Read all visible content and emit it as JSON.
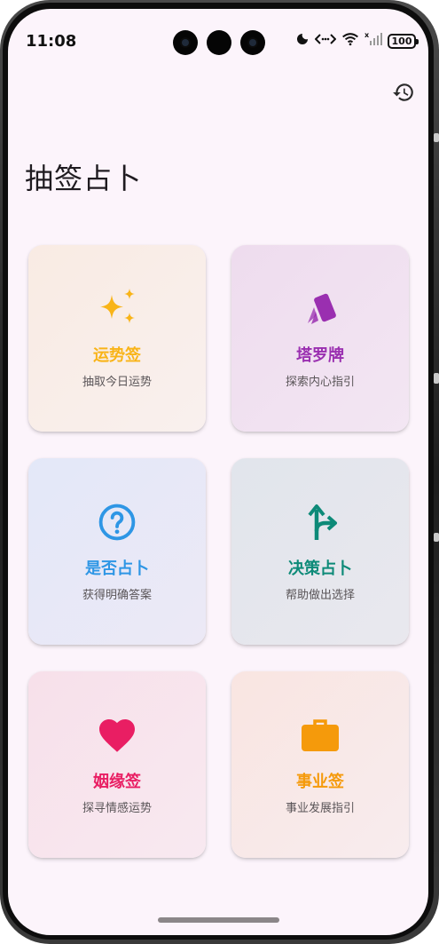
{
  "status_bar": {
    "time": "11:08",
    "battery": "100",
    "icons": [
      "moon-icon",
      "data-transfer-icon",
      "wifi-icon",
      "signal-icon",
      "battery-icon"
    ]
  },
  "header": {
    "history_icon": "history-icon",
    "title": "抽签占卜"
  },
  "cards": [
    {
      "title": "运势签",
      "subtitle": "抽取今日运势",
      "icon": "sparkles-icon",
      "color": "#f9b418",
      "bg": [
        "#f9ebe3",
        "#f9f0ee"
      ]
    },
    {
      "title": "塔罗牌",
      "subtitle": "探索内心指引",
      "icon": "cards-icon",
      "color": "#9a2fb0",
      "bg": [
        "#eedcee",
        "#f3e6f3"
      ]
    },
    {
      "title": "是否占卜",
      "subtitle": "获得明确答案",
      "icon": "question-circle-icon",
      "color": "#2e96e5",
      "bg": [
        "#e3e8f8",
        "#ece9f6"
      ]
    },
    {
      "title": "决策占卜",
      "subtitle": "帮助做出选择",
      "icon": "fork-arrow-icon",
      "color": "#0d8a78",
      "bg": [
        "#e1e5ec",
        "#e9e8ee"
      ]
    },
    {
      "title": "姻缘签",
      "subtitle": "探寻情感运势",
      "icon": "heart-icon",
      "color": "#e91e63",
      "bg": [
        "#f7e0ea",
        "#f8e9f0"
      ]
    },
    {
      "title": "事业签",
      "subtitle": "事业发展指引",
      "icon": "briefcase-icon",
      "color": "#f59a0b",
      "bg": [
        "#f9e5e1",
        "#f8ecee"
      ]
    }
  ]
}
